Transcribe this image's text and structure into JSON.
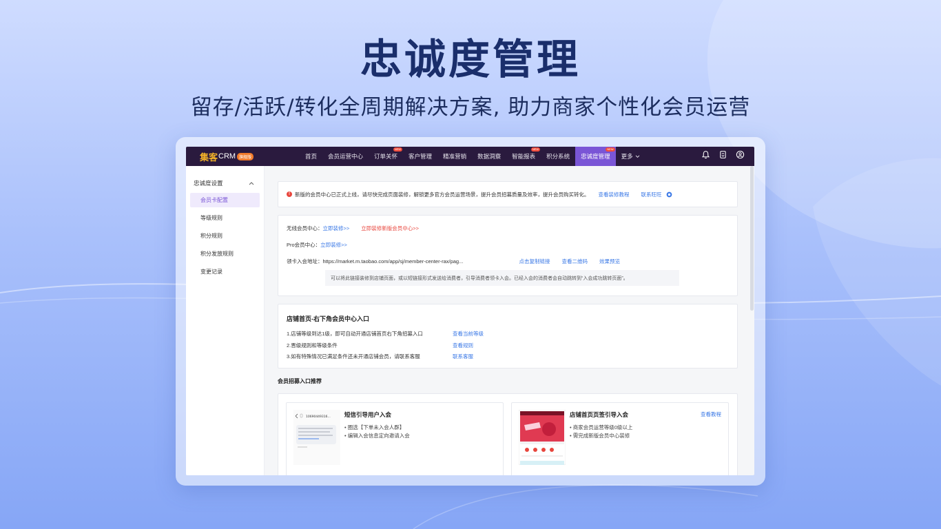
{
  "hero": {
    "title": "忠诚度管理",
    "subtitle": "留存/活跃/转化全周期解决方案, 助力商家个性化会员运营"
  },
  "topnav": {
    "logo_main": "集客",
    "logo_crm": "CRM",
    "logo_badge": "旗舰版",
    "items": [
      {
        "label": "首页",
        "new": false,
        "active": false
      },
      {
        "label": "会员运营中心",
        "new": false,
        "active": false
      },
      {
        "label": "订单关怀",
        "new": true,
        "active": false
      },
      {
        "label": "客户管理",
        "new": false,
        "active": false
      },
      {
        "label": "精准营销",
        "new": false,
        "active": false
      },
      {
        "label": "数据洞察",
        "new": false,
        "active": false
      },
      {
        "label": "智能报表",
        "new": true,
        "active": false
      },
      {
        "label": "积分系统",
        "new": false,
        "active": false
      },
      {
        "label": "忠诚度管理",
        "new": true,
        "active": true
      },
      {
        "label": "更多",
        "new": false,
        "active": false
      }
    ],
    "new_badge": "NEW",
    "icons": [
      "bell-icon",
      "clipboard-icon",
      "user-icon"
    ]
  },
  "sidebar": {
    "group_label": "忠诚度设置",
    "items": [
      {
        "label": "会员卡配置",
        "active": true
      },
      {
        "label": "等级规则",
        "active": false
      },
      {
        "label": "积分规则",
        "active": false
      },
      {
        "label": "积分发放规则",
        "active": false
      },
      {
        "label": "变更记录",
        "active": false
      }
    ]
  },
  "notice": {
    "text": "新版的会员中心已正式上线，请尽快完成页面装修，解锁更多官方会员运营场景，提升会员招募质量及效率，提升会员购买转化。",
    "link1": "查看装修教程",
    "link2": "联系旺旺"
  },
  "info": {
    "wireless_label": "无线会员中心：",
    "wireless_link": "立即装修>>",
    "wireless_link_new": "立即装修新版会员中心>>",
    "pro_label": "Pro会员中心：",
    "pro_link": "立即装修>>",
    "address_label": "领卡入会地址：",
    "address_value": "https://market.m.taobao.com/app/sj/member-center-rax/pag...",
    "copy_link": "点击复制链接",
    "qr_link": "查看二维码",
    "preview_link": "效果预览",
    "hint": "可以将此链接装修到店铺页面，或以短链接形式发送给消费者，引导消费者领卡入会。已经入会的消费者会自动跳转到“入会成功跳转页面”。"
  },
  "entry": {
    "title": "店铺首页-右下角会员中心入口",
    "rows": [
      {
        "text": "1.店铺等级到达1级，即可自动开通店铺首页右下角招募入口",
        "link": "查看当前等级"
      },
      {
        "text": "2.晋级规则和等级条件",
        "link": "查看规则"
      },
      {
        "text": "3.如有特殊情况已满足条件还未开通店铺会员，请联系客服",
        "link": "联系客服"
      }
    ]
  },
  "recommend": {
    "section_title": "会员招募入口推荐",
    "cards": [
      {
        "name": "短信引导用户入会",
        "lines": [
          "• 圈选【下单未入会人群】",
          "• 编辑入会信息定向邀请入会"
        ],
        "link": "",
        "thumb_number": "10690449316..."
      },
      {
        "name": "店铺首页页签引导入会",
        "lines": [
          "• 商家会员运营等级0级以上",
          "• 需完成新版会员中心装修"
        ],
        "link": "查看教程"
      }
    ]
  },
  "colors": {
    "nav_bg": "#2a1a3e",
    "accent": "#7a55d6",
    "link": "#3a78e6",
    "warn": "#e8453c",
    "title": "#1a2e6b"
  }
}
